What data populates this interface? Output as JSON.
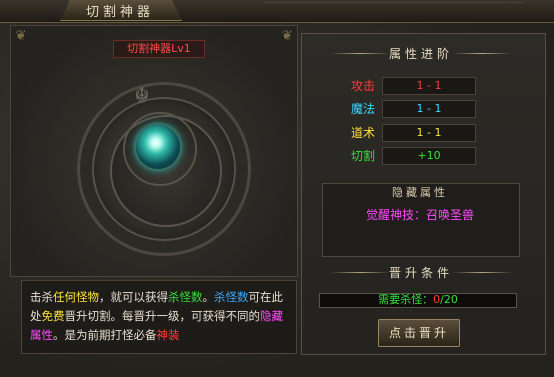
{
  "window": {
    "title": "切割神器"
  },
  "artifact": {
    "name": "切割神器Lv1"
  },
  "description": {
    "parts": [
      {
        "text": "击杀",
        "color": "white"
      },
      {
        "text": "任何怪物",
        "color": "yellow"
      },
      {
        "text": "，就可以获得",
        "color": "white"
      },
      {
        "text": "杀怪数",
        "color": "green"
      },
      {
        "text": "。",
        "color": "white"
      },
      {
        "text": "杀怪数",
        "color": "blue"
      },
      {
        "text": "可在此处",
        "color": "white"
      },
      {
        "text": "免费",
        "color": "yellow"
      },
      {
        "text": "晋升切割。每晋升一级，可获得不同的",
        "color": "white"
      },
      {
        "text": "隐藏属性",
        "color": "magenta"
      },
      {
        "text": "。是为前期打怪必备",
        "color": "white"
      },
      {
        "text": "神装",
        "color": "red"
      }
    ]
  },
  "attributes": {
    "title": "属性进阶",
    "rows": [
      {
        "label": "攻击",
        "value": "1 - 1",
        "label_color": "#ff3a3a",
        "value_color": "#ff3a3a"
      },
      {
        "label": "魔法",
        "value": "1 - 1",
        "label_color": "#3ad8ff",
        "value_color": "#3ad8ff"
      },
      {
        "label": "道术",
        "value": "1 - 1",
        "label_color": "#ffe23a",
        "value_color": "#ffe23a"
      },
      {
        "label": "切割",
        "value": "+10",
        "label_color": "#35e03a",
        "value_color": "#35e03a"
      }
    ]
  },
  "hidden": {
    "title": "隐藏属性",
    "skill": "觉醒神技：召唤圣兽"
  },
  "promote": {
    "title": "晋升条件",
    "kill_label": "需要杀怪：",
    "kill_current": "0",
    "kill_sep": "/",
    "kill_required": "20",
    "progress_fraction": 0.0,
    "button_label": "点击晋升"
  },
  "colors": {
    "accent_gold": "#e8dcc0",
    "red": "#ff3a3a",
    "green": "#35e03a",
    "magenta": "#ff49ff"
  }
}
